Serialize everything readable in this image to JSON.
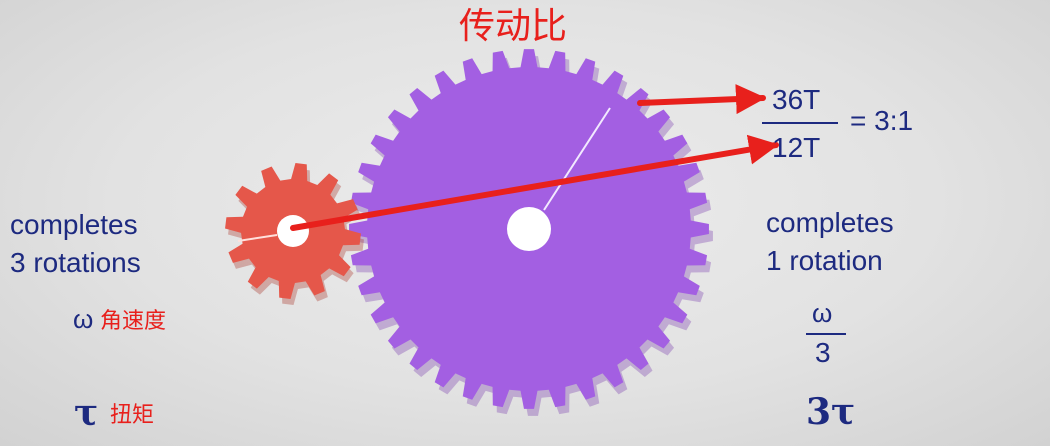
{
  "title": "传动比",
  "small_gear": {
    "caption": [
      "completes",
      "3 rotations"
    ],
    "omega_symbol": "ω",
    "omega_label": "角速度",
    "tau_symbol": "τ",
    "tau_label": "扭矩",
    "color": "#e5574a"
  },
  "large_gear": {
    "caption": [
      "completes",
      "1 rotation"
    ],
    "omega_numerator": "ω",
    "omega_denominator": "3",
    "torque": "3τ",
    "color": "#a35fe2"
  },
  "ratio": {
    "numerator": "36T",
    "denominator": "12T",
    "result": "= 3:1"
  },
  "colors": {
    "annotation_red": "#e8201c",
    "text_navy": "#1d2a80",
    "background": "#e4e4e4"
  }
}
